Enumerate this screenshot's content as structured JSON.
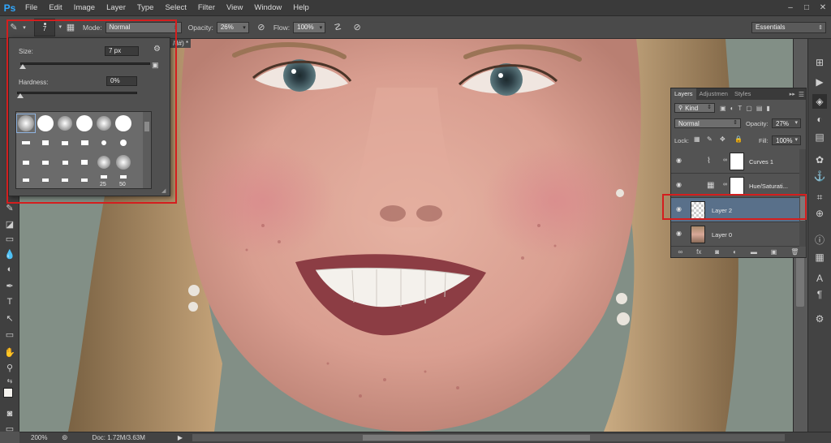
{
  "app": {
    "logo": "Ps"
  },
  "menu": [
    "File",
    "Edit",
    "Image",
    "Layer",
    "Type",
    "Select",
    "Filter",
    "View",
    "Window",
    "Help"
  ],
  "window_controls": [
    "–",
    "□",
    "✕"
  ],
  "options": {
    "brush_size_preview": "7",
    "mode_label": "Mode:",
    "mode_value": "Normal",
    "opacity_label": "Opacity:",
    "opacity_value": "26%",
    "flow_label": "Flow:",
    "flow_value": "100%",
    "workspace": "Essentials"
  },
  "document_tab": "/8#) *",
  "brush_picker": {
    "size_label": "Size:",
    "size_value": "7 px",
    "size_fraction": 0.02,
    "hardness_label": "Hardness:",
    "hardness_value": "0%",
    "hardness_fraction": 0.0,
    "brush_numbers": [
      "25",
      "50"
    ]
  },
  "layers_panel": {
    "tabs": [
      "Layers",
      "Adjustmen",
      "Styles"
    ],
    "filter_kind": "Kind",
    "blend_mode": "Normal",
    "opacity_label": "Opacity:",
    "opacity_value": "27%",
    "lock_label": "Lock:",
    "fill_label": "Fill:",
    "fill_value": "100%",
    "layers": [
      {
        "name": "Curves 1",
        "type": "adjustment",
        "selected": false
      },
      {
        "name": "Hue/Saturati...",
        "type": "adjustment",
        "selected": false
      },
      {
        "name": "Layer 2",
        "type": "transparent",
        "selected": true
      },
      {
        "name": "Layer 0",
        "type": "photo",
        "selected": false
      }
    ]
  },
  "status": {
    "zoom": "200%",
    "doc": "Doc: 1.72M/3.63M"
  },
  "colors": {
    "highlight": "#d41e1e",
    "selected_layer": "#59708a",
    "ui_bg": "#535353"
  }
}
